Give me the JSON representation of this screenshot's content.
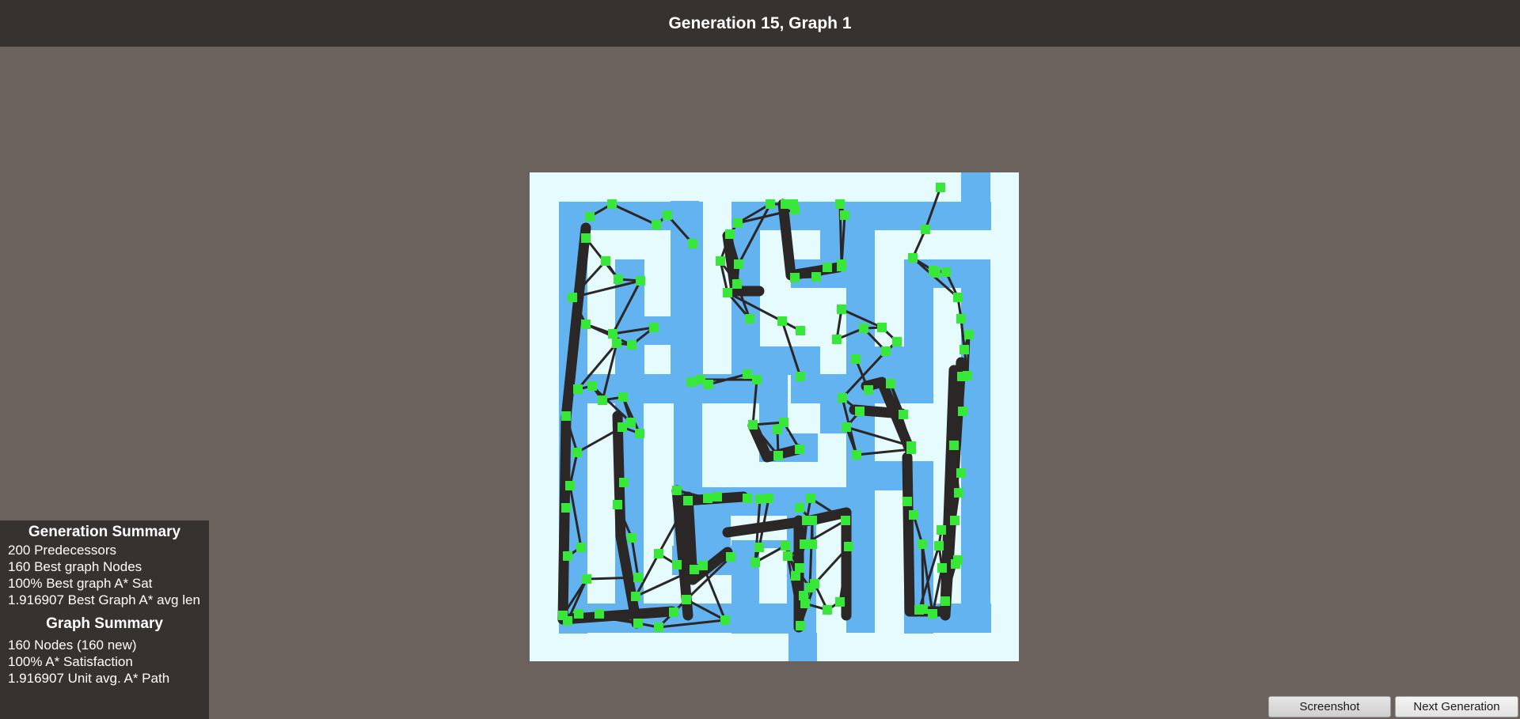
{
  "header": {
    "title": "Generation 15, Graph 1"
  },
  "colors": {
    "background": "#6b625d",
    "panel": "#353230",
    "maze_floor": "#e6fbfd",
    "maze_wall": "#62b3f0",
    "node": "#38e838",
    "edge": "#2b2727"
  },
  "generation_summary": {
    "title": "Generation Summary",
    "rows": [
      "200 Predecessors",
      "160   Best graph Nodes",
      "100%   Best graph A* Sat",
      "1.916907 Best Graph A* avg len"
    ]
  },
  "graph_summary": {
    "title": "Graph Summary",
    "rows": [
      "160  Nodes  (160 new)",
      "100%   A* Satisfaction",
      "1.916907 Unit avg. A* Path"
    ]
  },
  "buttons": {
    "screenshot": "Screenshot",
    "next_generation": "Next Generation"
  }
}
